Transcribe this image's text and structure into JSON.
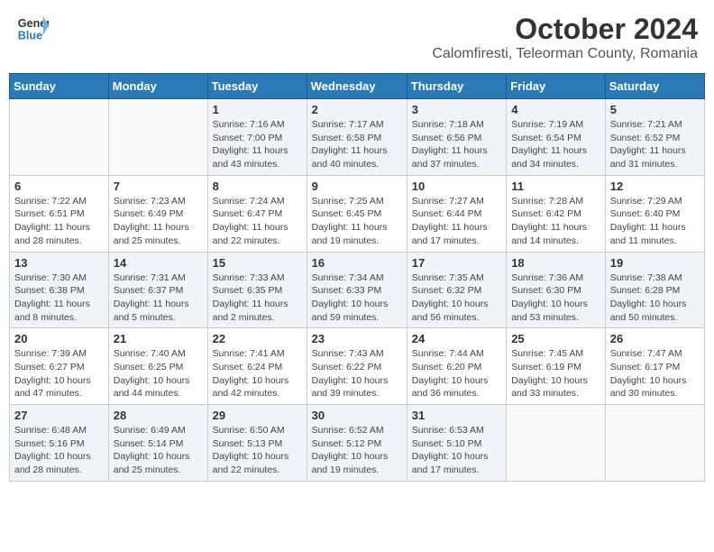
{
  "header": {
    "logo_line1": "General",
    "logo_line2": "Blue",
    "month": "October 2024",
    "location": "Calomfiresti, Teleorman County, Romania"
  },
  "weekdays": [
    "Sunday",
    "Monday",
    "Tuesday",
    "Wednesday",
    "Thursday",
    "Friday",
    "Saturday"
  ],
  "weeks": [
    [
      {
        "day": "",
        "info": ""
      },
      {
        "day": "",
        "info": ""
      },
      {
        "day": "1",
        "info": "Sunrise: 7:16 AM\nSunset: 7:00 PM\nDaylight: 11 hours and 43 minutes."
      },
      {
        "day": "2",
        "info": "Sunrise: 7:17 AM\nSunset: 6:58 PM\nDaylight: 11 hours and 40 minutes."
      },
      {
        "day": "3",
        "info": "Sunrise: 7:18 AM\nSunset: 6:56 PM\nDaylight: 11 hours and 37 minutes."
      },
      {
        "day": "4",
        "info": "Sunrise: 7:19 AM\nSunset: 6:54 PM\nDaylight: 11 hours and 34 minutes."
      },
      {
        "day": "5",
        "info": "Sunrise: 7:21 AM\nSunset: 6:52 PM\nDaylight: 11 hours and 31 minutes."
      }
    ],
    [
      {
        "day": "6",
        "info": "Sunrise: 7:22 AM\nSunset: 6:51 PM\nDaylight: 11 hours and 28 minutes."
      },
      {
        "day": "7",
        "info": "Sunrise: 7:23 AM\nSunset: 6:49 PM\nDaylight: 11 hours and 25 minutes."
      },
      {
        "day": "8",
        "info": "Sunrise: 7:24 AM\nSunset: 6:47 PM\nDaylight: 11 hours and 22 minutes."
      },
      {
        "day": "9",
        "info": "Sunrise: 7:25 AM\nSunset: 6:45 PM\nDaylight: 11 hours and 19 minutes."
      },
      {
        "day": "10",
        "info": "Sunrise: 7:27 AM\nSunset: 6:44 PM\nDaylight: 11 hours and 17 minutes."
      },
      {
        "day": "11",
        "info": "Sunrise: 7:28 AM\nSunset: 6:42 PM\nDaylight: 11 hours and 14 minutes."
      },
      {
        "day": "12",
        "info": "Sunrise: 7:29 AM\nSunset: 6:40 PM\nDaylight: 11 hours and 11 minutes."
      }
    ],
    [
      {
        "day": "13",
        "info": "Sunrise: 7:30 AM\nSunset: 6:38 PM\nDaylight: 11 hours and 8 minutes."
      },
      {
        "day": "14",
        "info": "Sunrise: 7:31 AM\nSunset: 6:37 PM\nDaylight: 11 hours and 5 minutes."
      },
      {
        "day": "15",
        "info": "Sunrise: 7:33 AM\nSunset: 6:35 PM\nDaylight: 11 hours and 2 minutes."
      },
      {
        "day": "16",
        "info": "Sunrise: 7:34 AM\nSunset: 6:33 PM\nDaylight: 10 hours and 59 minutes."
      },
      {
        "day": "17",
        "info": "Sunrise: 7:35 AM\nSunset: 6:32 PM\nDaylight: 10 hours and 56 minutes."
      },
      {
        "day": "18",
        "info": "Sunrise: 7:36 AM\nSunset: 6:30 PM\nDaylight: 10 hours and 53 minutes."
      },
      {
        "day": "19",
        "info": "Sunrise: 7:38 AM\nSunset: 6:28 PM\nDaylight: 10 hours and 50 minutes."
      }
    ],
    [
      {
        "day": "20",
        "info": "Sunrise: 7:39 AM\nSunset: 6:27 PM\nDaylight: 10 hours and 47 minutes."
      },
      {
        "day": "21",
        "info": "Sunrise: 7:40 AM\nSunset: 6:25 PM\nDaylight: 10 hours and 44 minutes."
      },
      {
        "day": "22",
        "info": "Sunrise: 7:41 AM\nSunset: 6:24 PM\nDaylight: 10 hours and 42 minutes."
      },
      {
        "day": "23",
        "info": "Sunrise: 7:43 AM\nSunset: 6:22 PM\nDaylight: 10 hours and 39 minutes."
      },
      {
        "day": "24",
        "info": "Sunrise: 7:44 AM\nSunset: 6:20 PM\nDaylight: 10 hours and 36 minutes."
      },
      {
        "day": "25",
        "info": "Sunrise: 7:45 AM\nSunset: 6:19 PM\nDaylight: 10 hours and 33 minutes."
      },
      {
        "day": "26",
        "info": "Sunrise: 7:47 AM\nSunset: 6:17 PM\nDaylight: 10 hours and 30 minutes."
      }
    ],
    [
      {
        "day": "27",
        "info": "Sunrise: 6:48 AM\nSunset: 5:16 PM\nDaylight: 10 hours and 28 minutes."
      },
      {
        "day": "28",
        "info": "Sunrise: 6:49 AM\nSunset: 5:14 PM\nDaylight: 10 hours and 25 minutes."
      },
      {
        "day": "29",
        "info": "Sunrise: 6:50 AM\nSunset: 5:13 PM\nDaylight: 10 hours and 22 minutes."
      },
      {
        "day": "30",
        "info": "Sunrise: 6:52 AM\nSunset: 5:12 PM\nDaylight: 10 hours and 19 minutes."
      },
      {
        "day": "31",
        "info": "Sunrise: 6:53 AM\nSunset: 5:10 PM\nDaylight: 10 hours and 17 minutes."
      },
      {
        "day": "",
        "info": ""
      },
      {
        "day": "",
        "info": ""
      }
    ]
  ]
}
